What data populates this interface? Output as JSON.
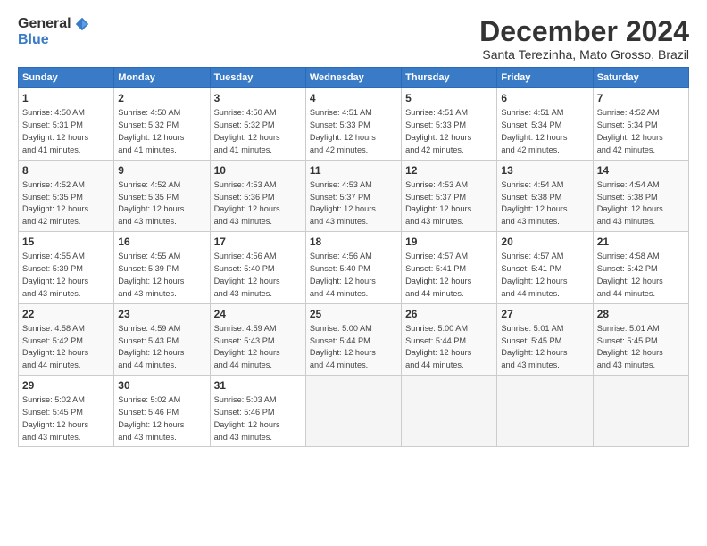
{
  "header": {
    "logo_general": "General",
    "logo_blue": "Blue",
    "month": "December 2024",
    "location": "Santa Terezinha, Mato Grosso, Brazil"
  },
  "weekdays": [
    "Sunday",
    "Monday",
    "Tuesday",
    "Wednesday",
    "Thursday",
    "Friday",
    "Saturday"
  ],
  "weeks": [
    [
      {
        "day": 1,
        "sunrise": "4:50 AM",
        "sunset": "5:31 PM",
        "daylight": "12 hours and 41 minutes."
      },
      {
        "day": 2,
        "sunrise": "4:50 AM",
        "sunset": "5:32 PM",
        "daylight": "12 hours and 41 minutes."
      },
      {
        "day": 3,
        "sunrise": "4:50 AM",
        "sunset": "5:32 PM",
        "daylight": "12 hours and 41 minutes."
      },
      {
        "day": 4,
        "sunrise": "4:51 AM",
        "sunset": "5:33 PM",
        "daylight": "12 hours and 42 minutes."
      },
      {
        "day": 5,
        "sunrise": "4:51 AM",
        "sunset": "5:33 PM",
        "daylight": "12 hours and 42 minutes."
      },
      {
        "day": 6,
        "sunrise": "4:51 AM",
        "sunset": "5:34 PM",
        "daylight": "12 hours and 42 minutes."
      },
      {
        "day": 7,
        "sunrise": "4:52 AM",
        "sunset": "5:34 PM",
        "daylight": "12 hours and 42 minutes."
      }
    ],
    [
      {
        "day": 8,
        "sunrise": "4:52 AM",
        "sunset": "5:35 PM",
        "daylight": "12 hours and 42 minutes."
      },
      {
        "day": 9,
        "sunrise": "4:52 AM",
        "sunset": "5:35 PM",
        "daylight": "12 hours and 43 minutes."
      },
      {
        "day": 10,
        "sunrise": "4:53 AM",
        "sunset": "5:36 PM",
        "daylight": "12 hours and 43 minutes."
      },
      {
        "day": 11,
        "sunrise": "4:53 AM",
        "sunset": "5:37 PM",
        "daylight": "12 hours and 43 minutes."
      },
      {
        "day": 12,
        "sunrise": "4:53 AM",
        "sunset": "5:37 PM",
        "daylight": "12 hours and 43 minutes."
      },
      {
        "day": 13,
        "sunrise": "4:54 AM",
        "sunset": "5:38 PM",
        "daylight": "12 hours and 43 minutes."
      },
      {
        "day": 14,
        "sunrise": "4:54 AM",
        "sunset": "5:38 PM",
        "daylight": "12 hours and 43 minutes."
      }
    ],
    [
      {
        "day": 15,
        "sunrise": "4:55 AM",
        "sunset": "5:39 PM",
        "daylight": "12 hours and 43 minutes."
      },
      {
        "day": 16,
        "sunrise": "4:55 AM",
        "sunset": "5:39 PM",
        "daylight": "12 hours and 43 minutes."
      },
      {
        "day": 17,
        "sunrise": "4:56 AM",
        "sunset": "5:40 PM",
        "daylight": "12 hours and 43 minutes."
      },
      {
        "day": 18,
        "sunrise": "4:56 AM",
        "sunset": "5:40 PM",
        "daylight": "12 hours and 44 minutes."
      },
      {
        "day": 19,
        "sunrise": "4:57 AM",
        "sunset": "5:41 PM",
        "daylight": "12 hours and 44 minutes."
      },
      {
        "day": 20,
        "sunrise": "4:57 AM",
        "sunset": "5:41 PM",
        "daylight": "12 hours and 44 minutes."
      },
      {
        "day": 21,
        "sunrise": "4:58 AM",
        "sunset": "5:42 PM",
        "daylight": "12 hours and 44 minutes."
      }
    ],
    [
      {
        "day": 22,
        "sunrise": "4:58 AM",
        "sunset": "5:42 PM",
        "daylight": "12 hours and 44 minutes."
      },
      {
        "day": 23,
        "sunrise": "4:59 AM",
        "sunset": "5:43 PM",
        "daylight": "12 hours and 44 minutes."
      },
      {
        "day": 24,
        "sunrise": "4:59 AM",
        "sunset": "5:43 PM",
        "daylight": "12 hours and 44 minutes."
      },
      {
        "day": 25,
        "sunrise": "5:00 AM",
        "sunset": "5:44 PM",
        "daylight": "12 hours and 44 minutes."
      },
      {
        "day": 26,
        "sunrise": "5:00 AM",
        "sunset": "5:44 PM",
        "daylight": "12 hours and 44 minutes."
      },
      {
        "day": 27,
        "sunrise": "5:01 AM",
        "sunset": "5:45 PM",
        "daylight": "12 hours and 43 minutes."
      },
      {
        "day": 28,
        "sunrise": "5:01 AM",
        "sunset": "5:45 PM",
        "daylight": "12 hours and 43 minutes."
      }
    ],
    [
      {
        "day": 29,
        "sunrise": "5:02 AM",
        "sunset": "5:45 PM",
        "daylight": "12 hours and 43 minutes."
      },
      {
        "day": 30,
        "sunrise": "5:02 AM",
        "sunset": "5:46 PM",
        "daylight": "12 hours and 43 minutes."
      },
      {
        "day": 31,
        "sunrise": "5:03 AM",
        "sunset": "5:46 PM",
        "daylight": "12 hours and 43 minutes."
      },
      null,
      null,
      null,
      null
    ]
  ]
}
